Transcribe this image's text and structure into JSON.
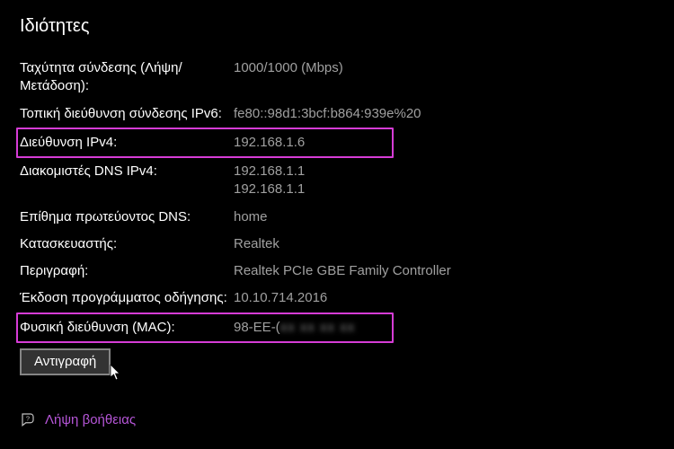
{
  "title": "Ιδιότητες",
  "rows": {
    "speed": {
      "label": "Ταχύτητα σύνδεσης (Λήψη/Μετάδοση):",
      "value": "1000/1000 (Mbps)"
    },
    "ipv6": {
      "label": "Τοπική διεύθυνση σύνδεσης IPv6:",
      "value": "fe80::98d1:3bcf:b864:939e%20"
    },
    "ipv4": {
      "label": "Διεύθυνση IPv4:",
      "value": "192.168.1.6"
    },
    "dns": {
      "label": "Διακομιστές DNS IPv4:",
      "value": "192.168.1.1\n192.168.1.1"
    },
    "suffix": {
      "label": "Επίθημα πρωτεύοντος DNS:",
      "value": "home"
    },
    "vendor": {
      "label": "Κατασκευαστής:",
      "value": "Realtek"
    },
    "desc": {
      "label": "Περιγραφή:",
      "value": "Realtek PCIe GBE Family Controller"
    },
    "driver": {
      "label": "Έκδοση προγράμματος οδήγησης:",
      "value": "10.10.714.2016"
    },
    "mac": {
      "label": "Φυσική διεύθυνση (MAC):",
      "value_visible": "98-EE-(",
      "value_hidden": "xx xx xx xx"
    }
  },
  "copy_button": "Αντιγραφή",
  "help_link": "Λήψη βοήθειας"
}
